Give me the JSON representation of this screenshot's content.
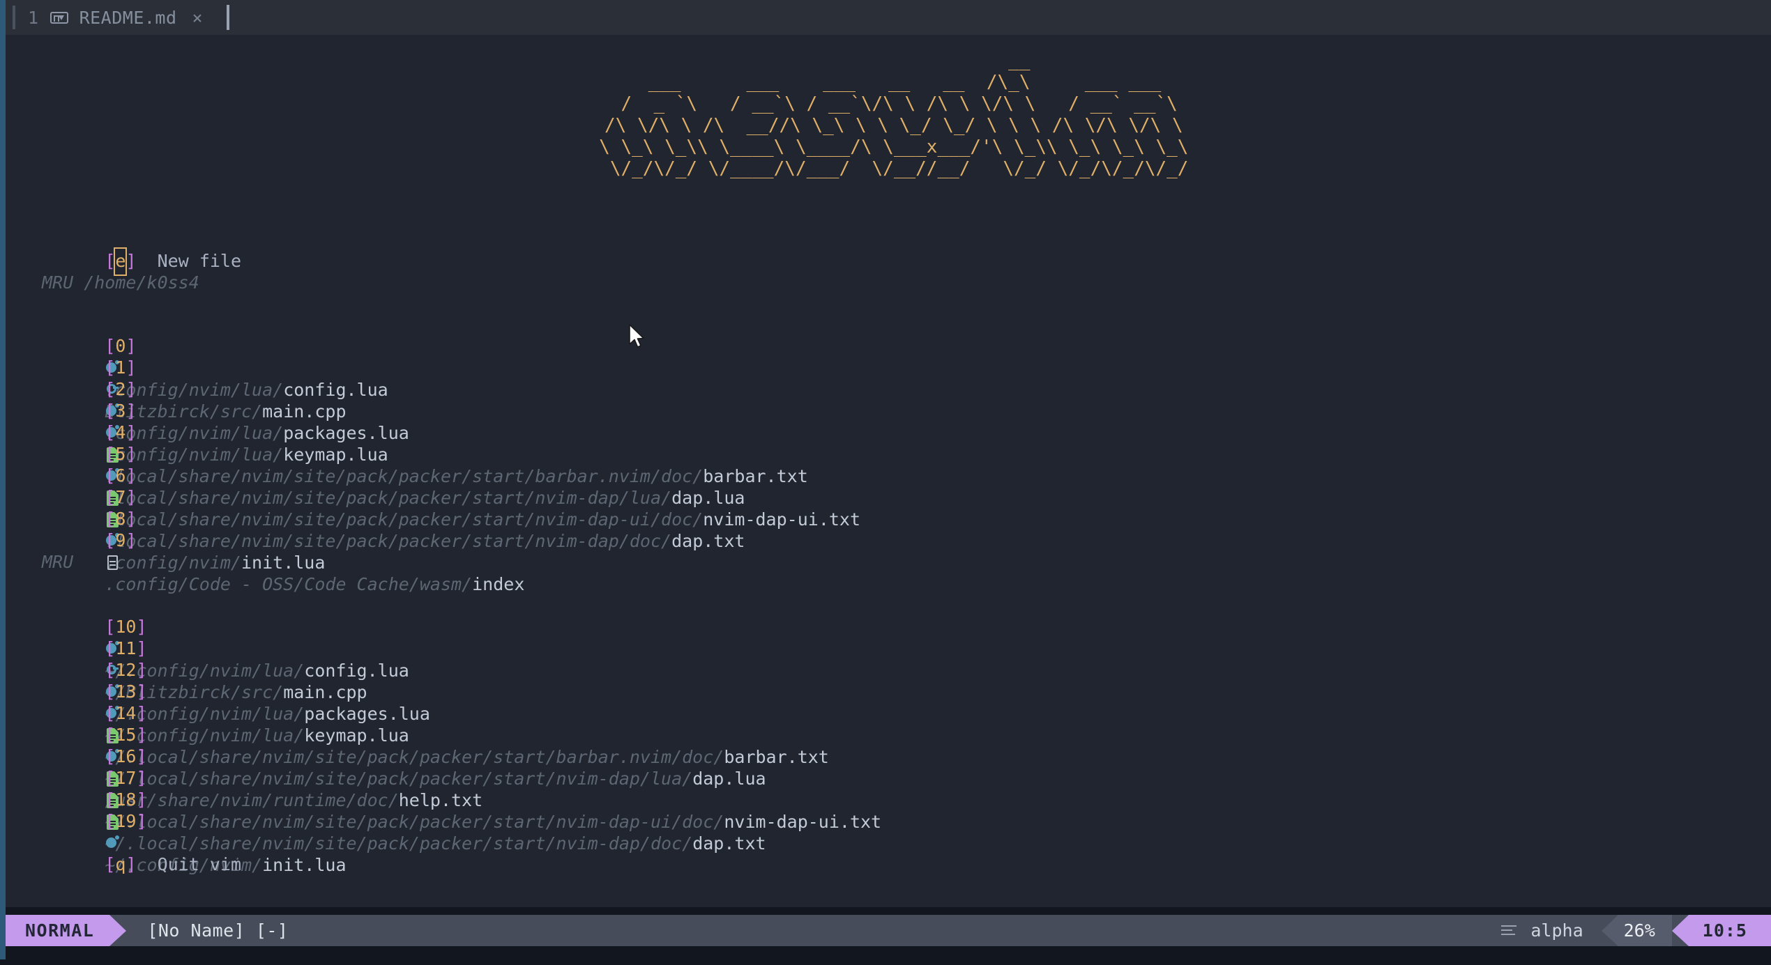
{
  "window": {
    "title_bar_visible": false,
    "accent_border_color": "#2e5a7a",
    "background": "#21252f"
  },
  "tabline": {
    "tab_index": "1",
    "filetype_icon": "markdown-icon",
    "filename": "README.md",
    "close_label": "×"
  },
  "header": {
    "ascii_art": "                        __\n   ___      ___    ___   __   __  /\\_\\     ___ ___\n  /  _ `\\   / __`\\ / __`\\/\\ \\ /\\ \\ \\/\\ \\   / __` __`\\\n /\\ \\/\\ \\ /\\  __//\\ \\_\\ \\ \\ \\_/ \\_/ \\ \\ \\ /\\ \\/\\ \\/\\ \\\n \\ \\_\\ \\_\\\\ \\____\\ \\____/\\ \\___x___/'\\ \\_\\\\ \\_\\ \\_\\ \\_\\\n  \\/_/\\/_/ \\/____/\\/___/  \\/__//__/   \\/_/ \\/_/\\/_/\\/_/",
    "ascii_color": "#e0af68"
  },
  "buttons": {
    "new_file": {
      "key": "e",
      "label": "New file",
      "cursor_on_key": true
    },
    "quit": {
      "key": "q",
      "label": "Quit vim"
    }
  },
  "sections": [
    {
      "heading": "MRU /home/k0ss4",
      "items": [
        {
          "key": "0",
          "icon": "lua-icon",
          "dir": ".config/nvim/lua/",
          "file": "config.lua"
        },
        {
          "key": "1",
          "icon": "cpp-icon",
          "dir": "Blitzbirck/src/",
          "file": "main.cpp"
        },
        {
          "key": "2",
          "icon": "lua-icon",
          "dir": ".config/nvim/lua/",
          "file": "packages.lua"
        },
        {
          "key": "3",
          "icon": "lua-icon",
          "dir": ".config/nvim/lua/",
          "file": "keymap.lua"
        },
        {
          "key": "4",
          "icon": "text-doc-icon",
          "dir": ".local/share/nvim/site/pack/packer/start/barbar.nvim/doc/",
          "file": "barbar.txt"
        },
        {
          "key": "5",
          "icon": "lua-icon",
          "dir": ".local/share/nvim/site/pack/packer/start/nvim-dap/lua/",
          "file": "dap.lua"
        },
        {
          "key": "6",
          "icon": "text-doc-icon",
          "dir": ".local/share/nvim/site/pack/packer/start/nvim-dap-ui/doc/",
          "file": "nvim-dap-ui.txt"
        },
        {
          "key": "7",
          "icon": "text-doc-icon",
          "dir": ".local/share/nvim/site/pack/packer/start/nvim-dap/doc/",
          "file": "dap.txt"
        },
        {
          "key": "8",
          "icon": "lua-icon",
          "dir": ".config/nvim/",
          "file": "init.lua"
        },
        {
          "key": "9",
          "icon": "plain-doc-icon",
          "dir": ".config/Code - OSS/Code Cache/wasm/",
          "file": "index"
        }
      ]
    },
    {
      "heading": "MRU",
      "items": [
        {
          "key": "10",
          "icon": "lua-icon",
          "dir": "~/.config/nvim/lua/",
          "file": "config.lua"
        },
        {
          "key": "11",
          "icon": "cpp-icon",
          "dir": "~/Blitzbirck/src/",
          "file": "main.cpp"
        },
        {
          "key": "12",
          "icon": "lua-icon",
          "dir": "~/.config/nvim/lua/",
          "file": "packages.lua"
        },
        {
          "key": "13",
          "icon": "lua-icon",
          "dir": "~/.config/nvim/lua/",
          "file": "keymap.lua"
        },
        {
          "key": "14",
          "icon": "text-doc-icon",
          "dir": "~/.local/share/nvim/site/pack/packer/start/barbar.nvim/doc/",
          "file": "barbar.txt"
        },
        {
          "key": "15",
          "icon": "lua-icon",
          "dir": "~/.local/share/nvim/site/pack/packer/start/nvim-dap/lua/",
          "file": "dap.lua"
        },
        {
          "key": "16",
          "icon": "text-doc-icon",
          "dir": "/usr/share/nvim/runtime/doc/",
          "file": "help.txt"
        },
        {
          "key": "17",
          "icon": "text-doc-icon",
          "dir": "~/.local/share/nvim/site/pack/packer/start/nvim-dap-ui/doc/",
          "file": "nvim-dap-ui.txt"
        },
        {
          "key": "18",
          "icon": "text-doc-icon",
          "dir": "~/.local/share/nvim/site/pack/packer/start/nvim-dap/doc/",
          "file": "dap.txt"
        },
        {
          "key": "19",
          "icon": "lua-icon",
          "dir": "~/.config/nvim/",
          "file": "init.lua"
        }
      ]
    }
  ],
  "statusline": {
    "mode": "NORMAL",
    "filename": "[No Name] [-]",
    "filetype_icon": "lines-icon",
    "filetype": "alpha",
    "progress": "26%",
    "location": "10:5",
    "mode_color": "#c39aec",
    "bar_color": "#474c5a"
  }
}
